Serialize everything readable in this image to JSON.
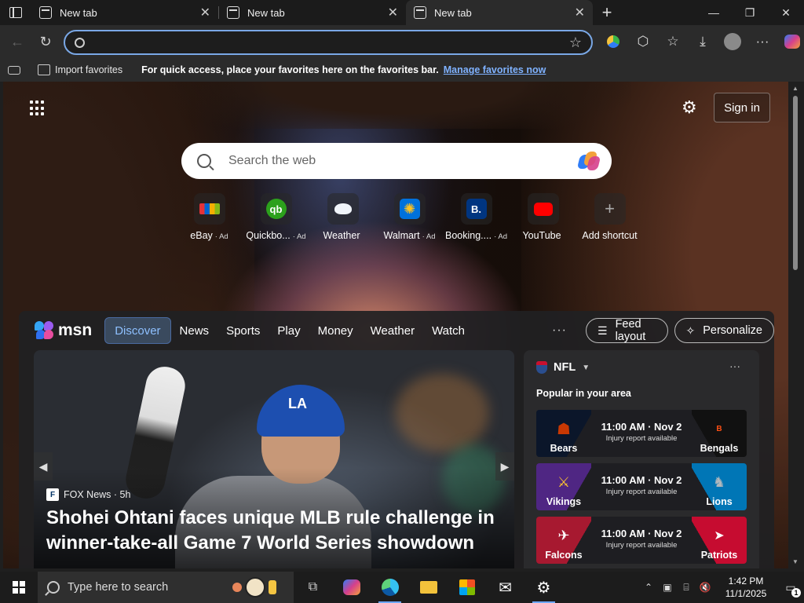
{
  "browser": {
    "tabs": [
      {
        "title": "New tab",
        "active": false
      },
      {
        "title": "New tab",
        "active": false
      },
      {
        "title": "New tab",
        "active": true
      }
    ],
    "address": {
      "value": "",
      "placeholder": ""
    }
  },
  "favorites_bar": {
    "import_label": "Import favorites",
    "message": "For quick access, place your favorites here on the favorites bar.",
    "manage_link": "Manage favorites now"
  },
  "newtab": {
    "signin_label": "Sign in",
    "search_placeholder": "Search the web",
    "shortcuts": [
      {
        "label": "eBay",
        "ad": "· Ad",
        "icon": "ebay-icon",
        "color": "#2f62c8"
      },
      {
        "label": "Quickbo...",
        "ad": "· Ad",
        "icon": "quickbooks-icon",
        "color": "#2ca01c"
      },
      {
        "label": "Weather",
        "ad": "",
        "icon": "weather-icon",
        "color": "#6aa7e0"
      },
      {
        "label": "Walmart",
        "ad": "· Ad",
        "icon": "walmart-icon",
        "color": "#0071dc"
      },
      {
        "label": "Booking....",
        "ad": "· Ad",
        "icon": "booking-icon",
        "color": "#003580"
      },
      {
        "label": "YouTube",
        "ad": "",
        "icon": "youtube-icon",
        "color": "#ff0000"
      },
      {
        "label": "Add shortcut",
        "ad": "",
        "icon": "plus-icon",
        "color": "#555555"
      }
    ]
  },
  "feed": {
    "brand": "msn",
    "nav": [
      "Discover",
      "News",
      "Sports",
      "Play",
      "Money",
      "Weather",
      "Watch"
    ],
    "more": "···",
    "feed_layout_label": "Feed layout",
    "personalize_label": "Personalize",
    "hero": {
      "source": "FOX News · 5h",
      "headline": "Shohei Ohtani faces unique MLB rule challenge in winner-take-all Game 7 World Series showdown"
    },
    "sidebar": {
      "league": "NFL",
      "subtitle": "Popular in your area",
      "games": [
        {
          "home": "Bears",
          "away": "Bengals",
          "time": "11:00 AM · Nov 2",
          "note": "Injury report available",
          "home_color": "#0b162a",
          "away_color": "#fb4f14"
        },
        {
          "home": "Vikings",
          "away": "Lions",
          "time": "11:00 AM · Nov 2",
          "note": "Injury report available",
          "home_color": "#4f2683",
          "away_color": "#0076b6"
        },
        {
          "home": "Falcons",
          "away": "Patriots",
          "time": "11:00 AM · Nov 2",
          "note": "Injury report available",
          "home_color": "#a71930",
          "away_color": "#c60c30"
        }
      ]
    }
  },
  "taskbar": {
    "search_placeholder": "Type here to search",
    "time": "1:42 PM",
    "date": "11/1/2025",
    "notification_count": "1"
  }
}
